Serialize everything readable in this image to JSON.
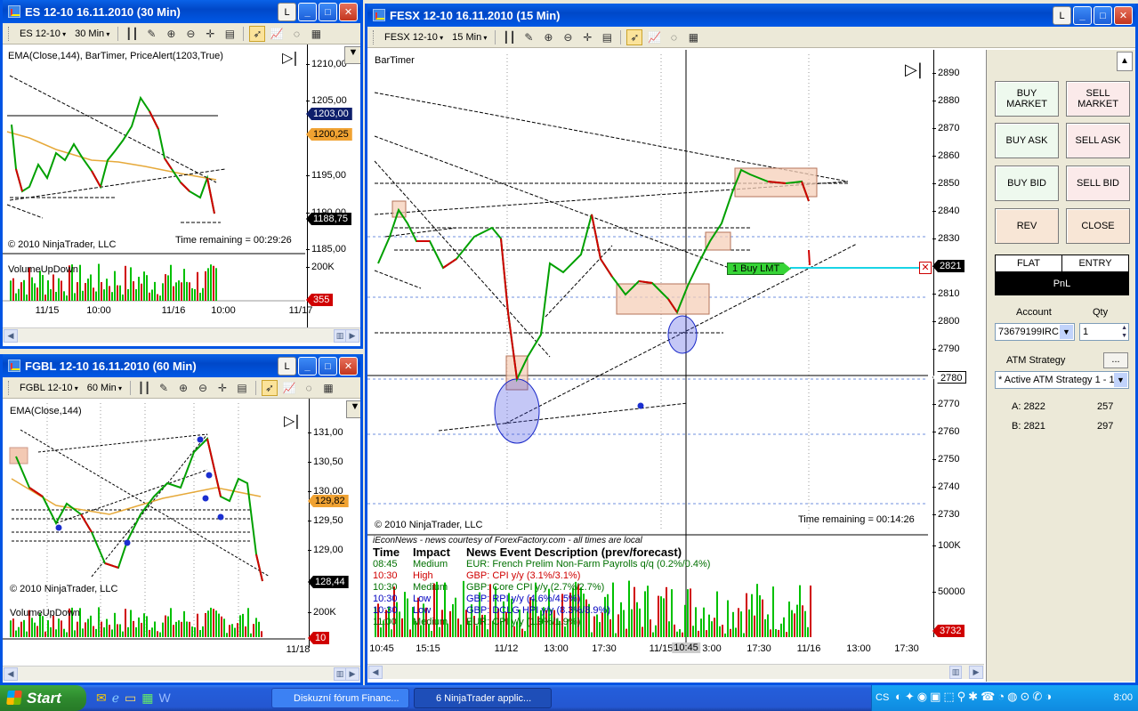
{
  "es": {
    "title": "ES 12-10  16.11.2010 (30 Min)",
    "instrument": "ES 12-10",
    "interval": "30 Min",
    "indicators": "EMA(Close,144), BarTimer, PriceAlert(1203,True)",
    "copyright": "© 2010 NinjaTrader, LLC",
    "remaining": "Time remaining = 00:29:26",
    "volume_label": "VolumeUpDown",
    "prices": [
      "1210,00",
      "1205,00",
      "1195,00",
      "1190,00",
      "1185,00"
    ],
    "flags": [
      "1203,00",
      "1200,25",
      "1188,75"
    ],
    "vol_ticks": [
      "200K"
    ],
    "vol_flag": "355",
    "xlabels": [
      "11/15",
      "10:00",
      "11/16",
      "10:00",
      "11/17"
    ]
  },
  "fgbl": {
    "title": "FGBL 12-10  16.11.2010 (60 Min)",
    "instrument": "FGBL 12-10",
    "interval": "60 Min",
    "indicators": "EMA(Close,144)",
    "copyright": "© 2010 NinjaTrader, LLC",
    "volume_label": "VolumeUpDown",
    "prices": [
      "131,00",
      "130,50",
      "130,00",
      "129,50",
      "129,00"
    ],
    "flags": [
      "129,82",
      "128,44"
    ],
    "vol_ticks": [
      "200K"
    ],
    "vol_flag": "10",
    "xlabels": [
      "11/18"
    ]
  },
  "fesx": {
    "title": "FESX 12-10  16.11.2010 (15 Min)",
    "instrument": "FESX 12-10",
    "interval": "15 Min",
    "indicators": "BarTimer",
    "copyright": "© 2010 NinjaTrader, LLC",
    "remaining": "Time remaining = 00:14:26",
    "order_label": "1  Buy LMT",
    "prices": [
      "2890",
      "2880",
      "2870",
      "2860",
      "2850",
      "2840",
      "2830",
      "2820",
      "2810",
      "2800",
      "2790",
      "2770",
      "2760",
      "2750",
      "2740",
      "2730"
    ],
    "flags": [
      "2821",
      "2780"
    ],
    "vol_ticks": [
      "100K",
      "50000"
    ],
    "vol_flag": "3732",
    "xlabels": [
      "10:45",
      "15:15",
      "11/12",
      "13:00",
      "17:30",
      "11/15",
      "10:45",
      "3:00",
      "17:30",
      "11/16",
      "13:00",
      "17:30"
    ],
    "news": {
      "header": "iEconNews - news courtesy of ForexFactory.com - all times are local",
      "cols": [
        "Time",
        "Impact",
        "News Event Description (prev/forecast)"
      ],
      "rows": [
        [
          "08:45",
          "Medium",
          "EUR: French Prelim Non-Farm Payrolls q/q (0.2%/0.4%)",
          "#007000"
        ],
        [
          "10:30",
          "High",
          "GBP: CPI y/y (3.1%/3.1%)",
          "#d00000"
        ],
        [
          "10:30",
          "Medium",
          "GBP: Core CPI y/y (2.7%/2.7%)",
          "#007000"
        ],
        [
          "10:30",
          "Low",
          "GBP: RPI y/y (4.6%/4.5%)",
          "#0000c0"
        ],
        [
          "10:30",
          "Low",
          "GBP: DCLG HPI y/y (8.3%/8.9%)",
          "#0000c0"
        ],
        [
          "11:00",
          "Medium",
          "EUR: CPI y/y (1.9%/1.9%)",
          "#007000"
        ]
      ]
    }
  },
  "panel": {
    "buttons": [
      [
        "BUY\nMARKET",
        "SELL\nMARKET"
      ],
      [
        "BUY ASK",
        "SELL ASK"
      ],
      [
        "BUY BID",
        "SELL BID"
      ],
      [
        "REV",
        "CLOSE"
      ]
    ],
    "flat": "FLAT",
    "entry": "ENTRY",
    "pnl": "PnL",
    "account_label": "Account",
    "qty_label": "Qty",
    "account": "73679199IRC",
    "qty": "1",
    "atm_label": "ATM Strategy",
    "atm_value": "* Active ATM Strategy 1 - 1",
    "atm_btn": "...",
    "a_label": "A: 2822",
    "a_qty": "257",
    "b_label": "B: 2821",
    "b_qty": "297"
  },
  "taskbar": {
    "start": "Start",
    "tasks": [
      "Diskuzní fórum Financ...",
      "6 NinjaTrader applic..."
    ],
    "lang": "CS",
    "clock": "8:00"
  }
}
